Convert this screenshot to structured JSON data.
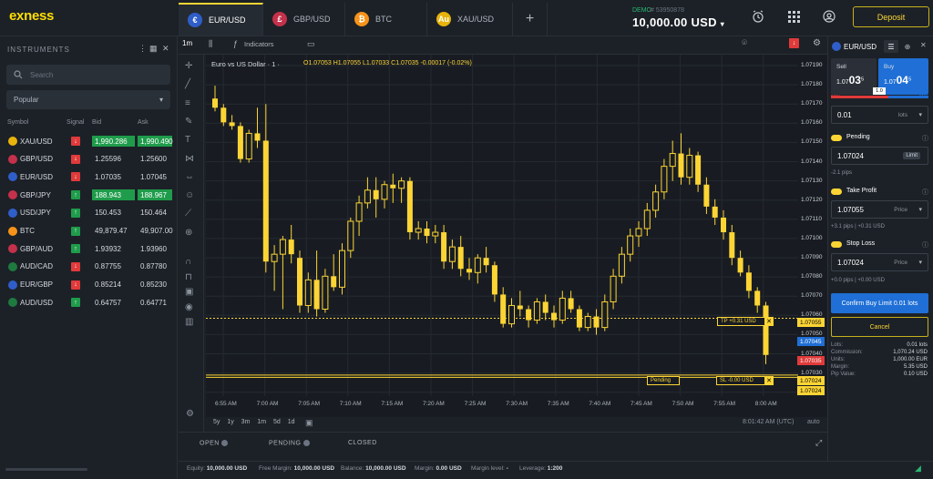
{
  "logo": "exness",
  "tabs": [
    {
      "label": "EUR/USD",
      "active": true
    },
    {
      "label": "GBP/USD",
      "active": false
    },
    {
      "label": "BTC",
      "active": false
    },
    {
      "label": "XAU/USD",
      "active": false
    }
  ],
  "account": {
    "type": "DEMO",
    "number": "# 53950878",
    "balance": "10,000.00 USD"
  },
  "deposit_label": "Deposit",
  "instruments": {
    "title": "INSTRUMENTS",
    "search_placeholder": "Search",
    "filter": "Popular",
    "columns": {
      "symbol": "Symbol",
      "signal": "Signal",
      "bid": "Bid",
      "ask": "Ask"
    },
    "rows": [
      {
        "symbol": "XAU/USD",
        "signal": "down",
        "bid": "1,990.286",
        "ask": "1,990.490",
        "hl": true,
        "color": "#e8b30c"
      },
      {
        "symbol": "GBP/USD",
        "signal": "down",
        "bid": "1.25596",
        "ask": "1.25600",
        "hl": false,
        "color": "#c4314b"
      },
      {
        "symbol": "EUR/USD",
        "signal": "down",
        "bid": "1.07035",
        "ask": "1.07045",
        "hl": false,
        "color": "#2f5ec9"
      },
      {
        "symbol": "GBP/JPY",
        "signal": "up",
        "bid": "188.943",
        "ask": "188.967",
        "hl": true,
        "color": "#c4314b"
      },
      {
        "symbol": "USD/JPY",
        "signal": "up",
        "bid": "150.453",
        "ask": "150.464",
        "hl": false,
        "color": "#2f5ec9"
      },
      {
        "symbol": "BTC",
        "signal": "up",
        "bid": "49,879.47",
        "ask": "49,907.00",
        "hl": false,
        "color": "#f7931a"
      },
      {
        "symbol": "GBP/AUD",
        "signal": "up",
        "bid": "1.93932",
        "ask": "1.93960",
        "hl": false,
        "color": "#c4314b"
      },
      {
        "symbol": "AUD/CAD",
        "signal": "down",
        "bid": "0.87755",
        "ask": "0.87780",
        "hl": false,
        "color": "#1e7a3f"
      },
      {
        "symbol": "EUR/GBP",
        "signal": "down",
        "bid": "0.85214",
        "ask": "0.85230",
        "hl": false,
        "color": "#2f5ec9"
      },
      {
        "symbol": "AUD/USD",
        "signal": "up",
        "bid": "0.64757",
        "ask": "0.64771",
        "hl": false,
        "color": "#1e7a3f"
      }
    ]
  },
  "toolbar": {
    "timeframe": "1m",
    "indicators": "Indicators"
  },
  "chart": {
    "title": "Euro vs US Dollar · 1 ·",
    "ohlc": "O1.07053 H1.07055 L1.07033 C1.07035 -0.00017 (-0.02%)",
    "y_labels": [
      "1.07190",
      "1.07180",
      "1.07170",
      "1.07160",
      "1.07150",
      "1.07140",
      "1.07130",
      "1.07120",
      "1.07110",
      "1.07100",
      "1.07090",
      "1.07080",
      "1.07070",
      "1.07060",
      "1.07050",
      "1.07040",
      "1.07030",
      "1.07020"
    ],
    "x_labels": [
      "6:55 AM",
      "7:00 AM",
      "7:05 AM",
      "7:10 AM",
      "7:15 AM",
      "7:20 AM",
      "7:25 AM",
      "7:30 AM",
      "7:35 AM",
      "7:40 AM",
      "7:45 AM",
      "7:50 AM",
      "7:55 AM",
      "8:00 AM"
    ],
    "tp_label": "TP  +0.31 USD",
    "sl_label": "SL  -0.00 USD",
    "pending_label": "Pending",
    "price_tags": {
      "tp": "1.07055",
      "ask": "1.07045",
      "bid": "1.07035",
      "pending": "1.07024",
      "sl": "1.07024"
    },
    "periods": "5y 1y 3m 1m 5d 1d",
    "clock": "8:01:42 AM (UTC)",
    "auto": "auto"
  },
  "chart_data": {
    "type": "candlestick",
    "title": "Euro vs US Dollar · 1 ·",
    "ylim": [
      1.07015,
      1.07195
    ],
    "x": [
      "6:53 AM",
      "6:54 AM",
      "6:55 AM",
      "6:56 AM",
      "6:57 AM",
      "6:58 AM",
      "6:59 AM",
      "7:00 AM",
      "7:01 AM",
      "7:02 AM",
      "7:03 AM",
      "7:04 AM",
      "7:05 AM",
      "7:06 AM",
      "7:07 AM",
      "7:08 AM",
      "7:09 AM",
      "7:10 AM",
      "7:11 AM",
      "7:12 AM",
      "7:13 AM",
      "7:14 AM",
      "7:15 AM",
      "7:16 AM",
      "7:17 AM",
      "7:18 AM",
      "7:19 AM",
      "7:20 AM",
      "7:21 AM",
      "7:22 AM",
      "7:23 AM",
      "7:24 AM",
      "7:25 AM",
      "7:26 AM",
      "7:27 AM",
      "7:28 AM",
      "7:29 AM",
      "7:30 AM",
      "7:31 AM",
      "7:32 AM",
      "7:33 AM",
      "7:34 AM",
      "7:35 AM",
      "7:36 AM",
      "7:37 AM",
      "7:38 AM",
      "7:39 AM",
      "7:40 AM",
      "7:41 AM",
      "7:42 AM",
      "7:43 AM",
      "7:44 AM",
      "7:45 AM",
      "7:46 AM",
      "7:47 AM",
      "7:48 AM",
      "7:49 AM",
      "7:50 AM",
      "7:51 AM",
      "7:52 AM",
      "7:53 AM",
      "7:54 AM",
      "7:55 AM",
      "7:56 AM",
      "7:57 AM",
      "7:58 AM",
      "7:59 AM",
      "8:00 AM",
      "8:01 AM"
    ],
    "candles": [
      [
        1.07175,
        1.07182,
        1.07168,
        1.0717
      ],
      [
        1.0717,
        1.07172,
        1.0716,
        1.07162
      ],
      [
        1.07162,
        1.07166,
        1.07158,
        1.0716
      ],
      [
        1.0716,
        1.07162,
        1.0714,
        1.07142
      ],
      [
        1.07142,
        1.07158,
        1.0714,
        1.07156
      ],
      [
        1.07156,
        1.0717,
        1.07148,
        1.07152
      ],
      [
        1.07152,
        1.07172,
        1.0708,
        1.07086
      ],
      [
        1.07086,
        1.07095,
        1.0707,
        1.0709
      ],
      [
        1.0709,
        1.071,
        1.0706,
        1.07098
      ],
      [
        1.07098,
        1.07106,
        1.07085,
        1.0709
      ],
      [
        1.07088,
        1.07092,
        1.07058,
        1.07062
      ],
      [
        1.07062,
        1.0708,
        1.07058,
        1.07076
      ],
      [
        1.07076,
        1.07092,
        1.07056,
        1.0706
      ],
      [
        1.0706,
        1.07082,
        1.07058,
        1.07078
      ],
      [
        1.07078,
        1.0709,
        1.0707,
        1.07072
      ],
      [
        1.07072,
        1.07096,
        1.07068,
        1.07092
      ],
      [
        1.07092,
        1.0711,
        1.07088,
        1.07108
      ],
      [
        1.07108,
        1.07122,
        1.071,
        1.07118
      ],
      [
        1.07118,
        1.07132,
        1.07115,
        1.07125
      ],
      [
        1.07125,
        1.07132,
        1.0711,
        1.0712
      ],
      [
        1.0712,
        1.0713,
        1.07115,
        1.07128
      ],
      [
        1.07128,
        1.07134,
        1.07118,
        1.07126
      ],
      [
        1.07126,
        1.07132,
        1.07118,
        1.0713
      ],
      [
        1.0713,
        1.07132,
        1.07098,
        1.07102
      ],
      [
        1.07102,
        1.07108,
        1.07098,
        1.07104
      ],
      [
        1.07104,
        1.07108,
        1.07096,
        1.071
      ],
      [
        1.071,
        1.07106,
        1.07096,
        1.07102
      ],
      [
        1.07102,
        1.07106,
        1.07082,
        1.07086
      ],
      [
        1.07086,
        1.07098,
        1.07082,
        1.07094
      ],
      [
        1.07094,
        1.071,
        1.07078,
        1.07082
      ],
      [
        1.07082,
        1.07088,
        1.07076,
        1.0708
      ],
      [
        1.0708,
        1.0709,
        1.07074,
        1.07088
      ],
      [
        1.07088,
        1.07094,
        1.0708,
        1.07084
      ],
      [
        1.07084,
        1.07086,
        1.07064,
        1.07068
      ],
      [
        1.07068,
        1.07072,
        1.0705,
        1.07052
      ],
      [
        1.07052,
        1.07066,
        1.0705,
        1.07062
      ],
      [
        1.07062,
        1.0707,
        1.07056,
        1.0706
      ],
      [
        1.0706,
        1.07062,
        1.0705,
        1.07054
      ],
      [
        1.07054,
        1.07066,
        1.07052,
        1.07064
      ],
      [
        1.07064,
        1.07068,
        1.07054,
        1.07058
      ],
      [
        1.07058,
        1.07062,
        1.0705,
        1.07054
      ],
      [
        1.07054,
        1.0707,
        1.07052,
        1.07066
      ],
      [
        1.07066,
        1.0707,
        1.07058,
        1.0706
      ],
      [
        1.0706,
        1.07062,
        1.07048,
        1.0705
      ],
      [
        1.0705,
        1.07058,
        1.07048,
        1.07056
      ],
      [
        1.07056,
        1.0706,
        1.07046,
        1.0705
      ],
      [
        1.0705,
        1.07068,
        1.07048,
        1.07064
      ],
      [
        1.07064,
        1.07082,
        1.0706,
        1.07078
      ],
      [
        1.07078,
        1.07094,
        1.07074,
        1.0709
      ],
      [
        1.0709,
        1.07104,
        1.07086,
        1.071
      ],
      [
        1.071,
        1.07108,
        1.07094,
        1.07104
      ],
      [
        1.07104,
        1.07118,
        1.071,
        1.07114
      ],
      [
        1.07114,
        1.07128,
        1.0711,
        1.07124
      ],
      [
        1.07124,
        1.07142,
        1.0712,
        1.07138
      ],
      [
        1.07138,
        1.07152,
        1.0713,
        1.07145
      ],
      [
        1.07145,
        1.07156,
        1.07128,
        1.07132
      ],
      [
        1.07132,
        1.07148,
        1.07128,
        1.07144
      ],
      [
        1.07144,
        1.07146,
        1.07124,
        1.07128
      ],
      [
        1.07128,
        1.07132,
        1.07112,
        1.07116
      ],
      [
        1.07116,
        1.0712,
        1.07106,
        1.0711
      ],
      [
        1.0711,
        1.07114,
        1.07098,
        1.07102
      ],
      [
        1.07102,
        1.07106,
        1.07084,
        1.07088
      ],
      [
        1.07088,
        1.07092,
        1.07078,
        1.0708
      ],
      [
        1.0708,
        1.07084,
        1.07066,
        1.0707
      ],
      [
        1.0707,
        1.07072,
        1.07058,
        1.07062
      ],
      [
        1.07062,
        1.07064,
        1.0703,
        1.07035
      ]
    ],
    "levels": {
      "tp": 1.07055,
      "pending": 1.07024,
      "sl": 1.07024,
      "ask": 1.07045,
      "bid": 1.07035
    }
  },
  "bottom_tabs": [
    {
      "label": "OPEN"
    },
    {
      "label": "PENDING"
    },
    {
      "label": "CLOSED"
    }
  ],
  "status": {
    "equity_label": "Equity:",
    "equity": "10,000.00 USD",
    "free_margin_label": "Free Margin:",
    "free_margin": "10,000.00 USD",
    "balance_label": "Balance:",
    "balance": "10,000.00 USD",
    "margin_label": "Margin:",
    "margin": "0.00 USD",
    "margin_level_label": "Margin level:",
    "margin_level": "-",
    "leverage_label": "Leverage:",
    "leverage": "1:200"
  },
  "order": {
    "symbol": "EUR/USD",
    "sell_label": "Sell",
    "sell_price_pre": "1.07",
    "sell_price_big": "03",
    "sell_price_sup": "5",
    "buy_label": "Buy",
    "buy_price_pre": "1.07",
    "buy_price_big": "04",
    "buy_price_sup": "5",
    "spread": "1.0",
    "spread_pct_left": "59%",
    "spread_pct_right": "41%",
    "volume": "0.01",
    "volume_unit": "lots",
    "pending_label": "Pending",
    "pending_price": "1.07024",
    "pending_type": "Limit",
    "pending_sub": "-2.1 pips",
    "tp_label": "Take Profit",
    "tp_price": "1.07055",
    "tp_unit": "Price",
    "tp_sub": "+3.1 pips  |  +0.31 USD",
    "sl_label": "Stop Loss",
    "sl_price": "1.07024",
    "sl_unit": "Price",
    "sl_sub": "+0.0 pips  |  +0.00 USD",
    "confirm_label": "Confirm Buy Limit 0.01 lots",
    "cancel_label": "Cancel",
    "info": [
      {
        "k": "Lots:",
        "v": "0.01 lots"
      },
      {
        "k": "Commission:",
        "v": "1,070.24 USD"
      },
      {
        "k": "Units:",
        "v": "1,000.00 EUR"
      },
      {
        "k": "Margin:",
        "v": "5.35 USD"
      },
      {
        "k": "Pip Value:",
        "v": "0.10 USD"
      }
    ]
  }
}
